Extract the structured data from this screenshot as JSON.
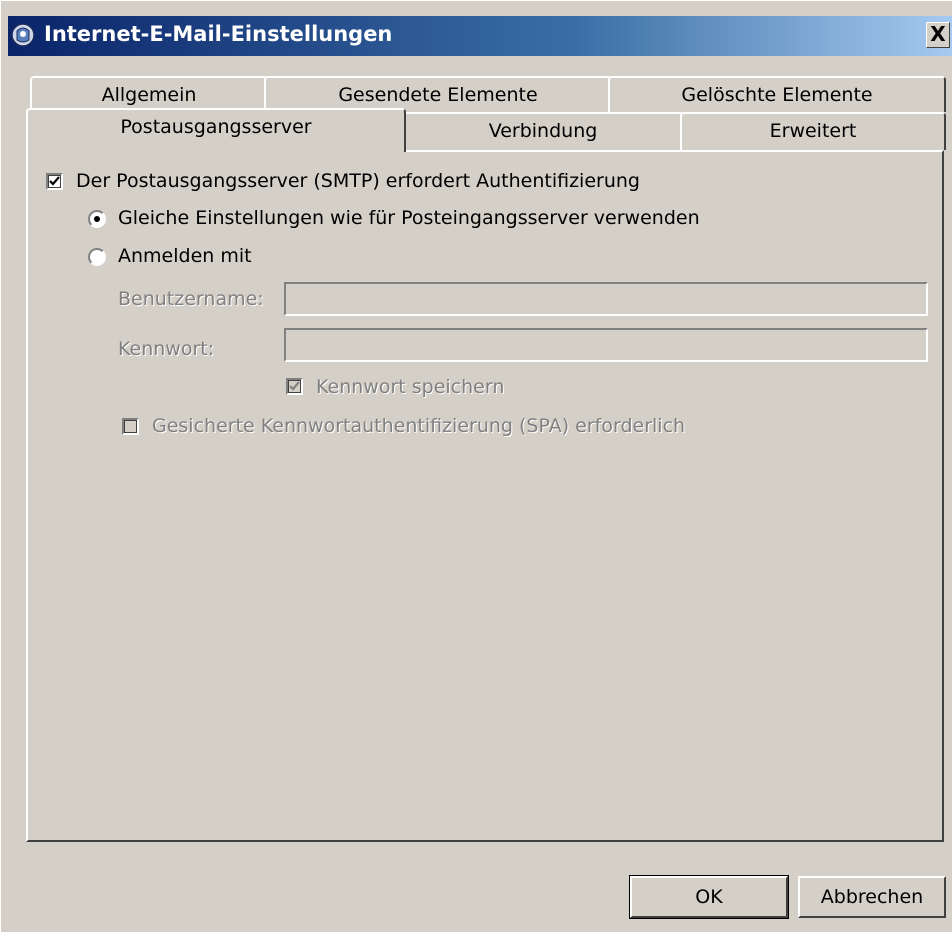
{
  "window": {
    "title": "Internet-E-Mail-Einstellungen",
    "close_label": "X",
    "icon": "outlook-mail-icon"
  },
  "tabs": {
    "row1": [
      {
        "label": "Allgemein"
      },
      {
        "label": "Gesendete Elemente"
      },
      {
        "label": "Gelöschte Elemente"
      }
    ],
    "row2": [
      {
        "label": "Postausgangsserver",
        "active": true
      },
      {
        "label": "Verbindung"
      },
      {
        "label": "Erweitert"
      }
    ]
  },
  "smtp": {
    "auth_required_label": "Der Postausgangsserver (SMTP) erfordert Authentifizierung",
    "auth_required_checked": true,
    "same_settings_label": "Gleiche Einstellungen wie für Posteingangsserver verwenden",
    "same_settings_selected": true,
    "login_with_label": "Anmelden mit",
    "login_with_selected": false,
    "username_label": "Benutzername:",
    "username_value": "",
    "password_label": "Kennwort:",
    "password_value": "",
    "save_password_label": "Kennwort speichern",
    "save_password_checked": true,
    "spa_label": "Gesicherte Kennwortauthentifizierung (SPA) erforderlich",
    "spa_checked": false
  },
  "buttons": {
    "ok_label": "OK",
    "cancel_label": "Abbrechen"
  },
  "colors": {
    "dialog_bg": "#d4d0c8",
    "titlebar_start": "#0a246a",
    "titlebar_end": "#a6caf0",
    "disabled_text": "#808080"
  }
}
